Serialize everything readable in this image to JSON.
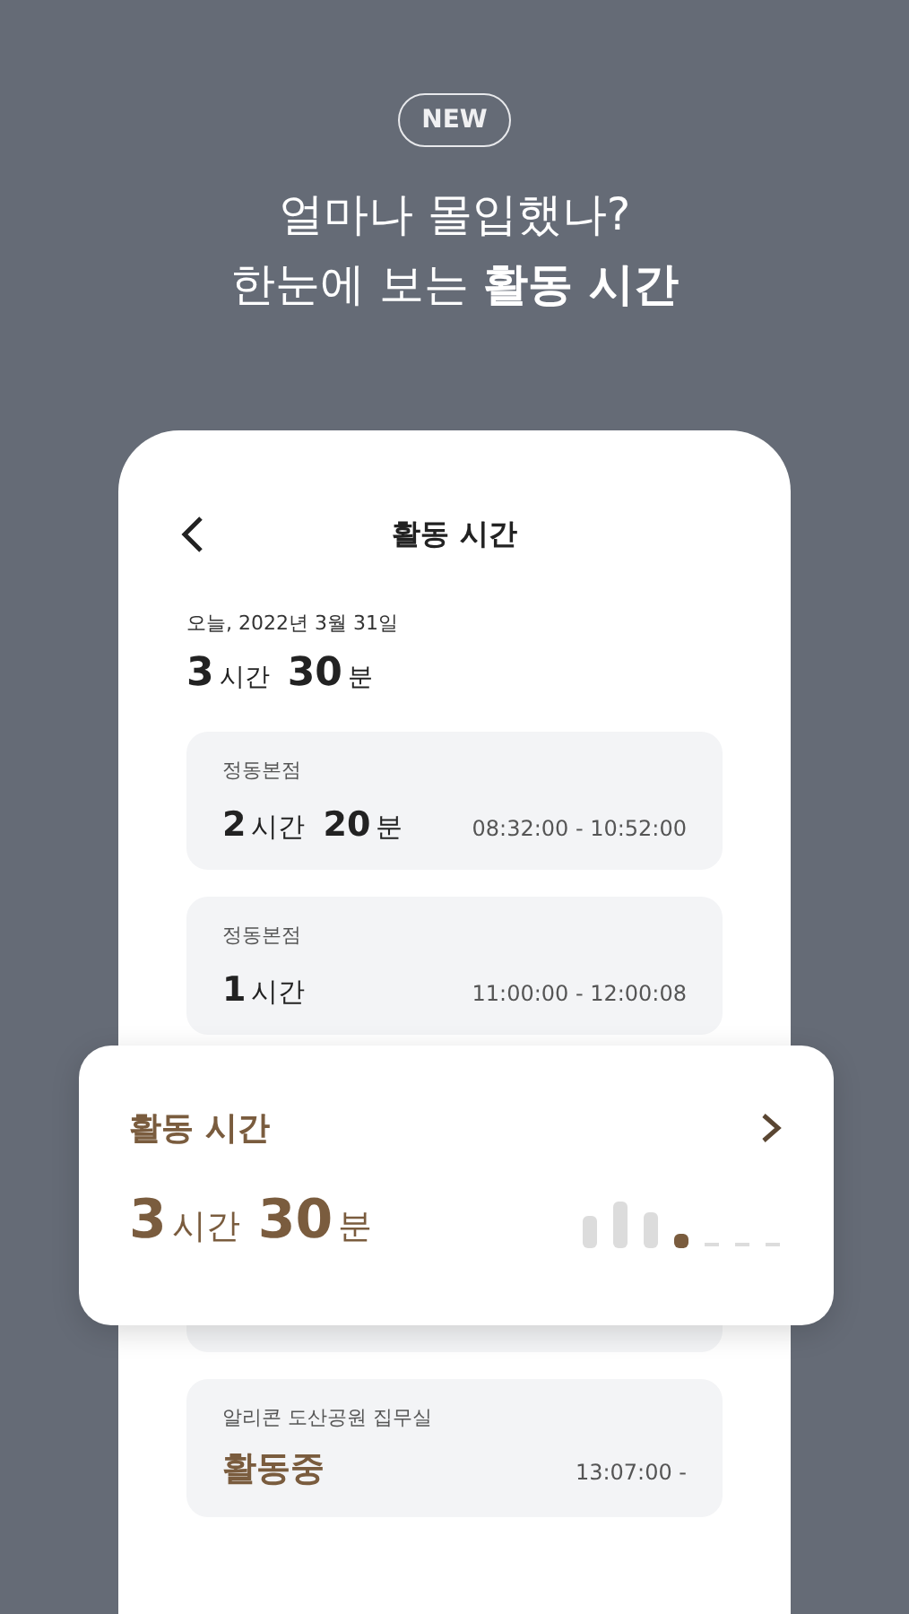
{
  "badge": "NEW",
  "headline": [
    "얼마나 몰입했나?",
    "한눈에 보는 **활동 시간**"
  ],
  "screen": {
    "title": "활동 시간",
    "date": "오늘, 2022년 3월 31일",
    "total": [
      {
        "num": "3",
        "unit": "시간"
      },
      {
        "num": "30",
        "unit": "분"
      }
    ],
    "entries": [
      {
        "kind": "duration",
        "place": "정동본점",
        "parts": [
          {
            "num": "2",
            "unit": "시간"
          },
          {
            "num": "20",
            "unit": "분"
          }
        ],
        "range": "08:32:00 - 10:52:00"
      },
      {
        "kind": "duration",
        "place": "정동본점",
        "parts": [
          {
            "num": "1",
            "unit": "시간"
          }
        ],
        "range": "11:00:00 - 12:00:08"
      },
      {
        "kind": "hidden"
      },
      {
        "kind": "active",
        "place": "알리콘 도산공원 집무실",
        "status": "활동중",
        "range": "13:07:00 -"
      }
    ]
  },
  "summary_card": {
    "title": "활동 시간",
    "total": [
      {
        "num": "3",
        "unit": "시간"
      },
      {
        "num": "30",
        "unit": "분"
      }
    ]
  }
}
